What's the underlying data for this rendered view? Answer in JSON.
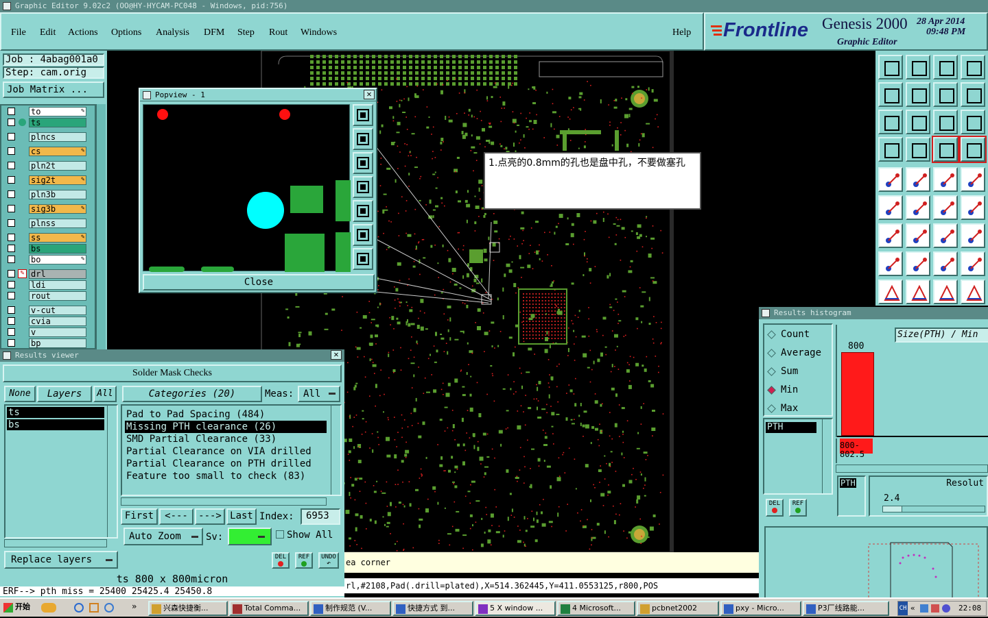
{
  "window": {
    "title": "Graphic Editor 9.02c2 (OO@HY-HYCAM-PC048 - Windows, pid:756)"
  },
  "menu": {
    "items": [
      "File",
      "Edit",
      "Actions",
      "Options",
      "Analysis",
      "DFM",
      "Step",
      "Rout",
      "Windows"
    ],
    "help": "Help"
  },
  "brand": {
    "logo": "Frontline",
    "product": "Genesis 2000",
    "subtitle": "Graphic Editor",
    "date": "28 Apr 2014",
    "time": "09:48 PM"
  },
  "job": {
    "job_label": "Job : 4abag001a0",
    "step_label": "Step: cam.orig",
    "matrix_button": "Job Matrix ..."
  },
  "layers": [
    {
      "name": "to"
    },
    {
      "name": "ts"
    },
    {
      "name": "plncs"
    },
    {
      "name": "cs"
    },
    {
      "name": "pln2t"
    },
    {
      "name": "sig2t"
    },
    {
      "name": "pln3b"
    },
    {
      "name": "sig3b"
    },
    {
      "name": "plnss"
    },
    {
      "name": "ss"
    },
    {
      "name": "bs"
    },
    {
      "name": "bo"
    },
    {
      "name": "drl"
    },
    {
      "name": "ldi"
    },
    {
      "name": "rout"
    },
    {
      "name": "v-cut"
    },
    {
      "name": "cvia"
    },
    {
      "name": "v"
    },
    {
      "name": "bp"
    }
  ],
  "popview": {
    "title": "Popview - 1",
    "close": "Close"
  },
  "callout": {
    "text": "1.点亮的0.8mm的孔也是盘中孔，不要做塞孔"
  },
  "results_viewer": {
    "title": "Results viewer",
    "header": "Solder Mask Checks",
    "none_btn": "None",
    "layers_btn": "Layers",
    "all_btn": "All",
    "categories_btn": "Categories (20)",
    "meas_label": "Meas:",
    "meas_value": "All",
    "layer_list": [
      "ts",
      "bs"
    ],
    "categories": [
      "Pad to Pad Spacing (484)",
      "Missing PTH clearance (26)",
      "SMD Partial Clearance (33)",
      "Partial Clearance on VIA drilled",
      "Partial Clearance on PTH drilled",
      "Feature too small to check (83)"
    ],
    "selected_index": 1,
    "first": "First",
    "prev": "<---",
    "next": "--->",
    "last": "Last",
    "index_label": "Index:",
    "index_value": "6953",
    "auto_zoom": "Auto Zoom",
    "sv_label": "Sv:",
    "show_all": "Show All",
    "replace_layers": "Replace layers",
    "del": "DEL",
    "ref": "REF",
    "undo": "UNDO",
    "size_line": "ts 800 x 800micron",
    "err_line": "ERF--> pth miss = 25400 25425.4 25450.8"
  },
  "status": {
    "line1": "ea corner",
    "line2": "rl,#2108,Pad(.drill=plated),X=514.362445,Y=411.0553125,r800,POS"
  },
  "histogram": {
    "title": "Results histogram",
    "options": [
      "Count",
      "Average",
      "Sum",
      "Min",
      "Max"
    ],
    "selected": "Min",
    "field_label": "Size(PTH) / Min",
    "list_item": "PTH",
    "bar_value_label": "800",
    "bar_range": "800-802.5",
    "bar_fraction": 1.0,
    "resolution_label": "Resolut",
    "resolution_value": "2.4",
    "small_label": "PTH",
    "del": "DEL",
    "ref": "REF"
  },
  "taskbar": {
    "start": "开始",
    "tasks": [
      "兴森快捷衡...",
      "Total Comma...",
      "制作规范 (V...",
      "快捷方式 到...",
      "5 X window ...",
      "4 Microsoft...",
      "pcbnet2002",
      "pxy - Micro...",
      "P3厂线路能..."
    ],
    "tray_prefix": "CH",
    "clock": "22:08"
  },
  "colors": {
    "panel": "#8fd6d1",
    "pcb_green": "#5a9e2f",
    "red": "#ff1010",
    "cyan": "#00ffff"
  }
}
